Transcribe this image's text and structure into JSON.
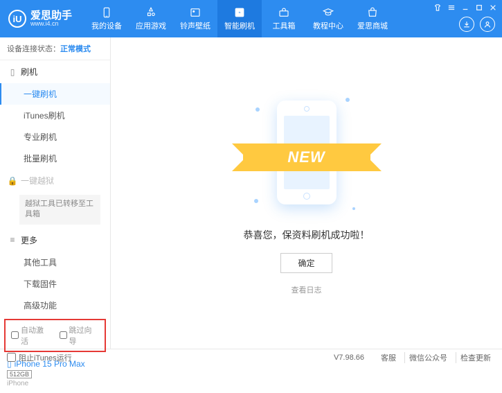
{
  "header": {
    "logo_letter": "iU",
    "app_name": "爱思助手",
    "url": "www.i4.cn",
    "nav": [
      {
        "label": "我的设备"
      },
      {
        "label": "应用游戏"
      },
      {
        "label": "铃声壁纸"
      },
      {
        "label": "智能刷机"
      },
      {
        "label": "工具箱"
      },
      {
        "label": "教程中心"
      },
      {
        "label": "爱思商城"
      }
    ]
  },
  "sidebar": {
    "conn_label": "设备连接状态：",
    "conn_mode": "正常模式",
    "sec_flash": "刷机",
    "items_flash": [
      "一键刷机",
      "iTunes刷机",
      "专业刷机",
      "批量刷机"
    ],
    "sec_jailbreak": "一键越狱",
    "jailbreak_note": "越狱工具已转移至工具箱",
    "sec_more": "更多",
    "items_more": [
      "其他工具",
      "下载固件",
      "高级功能"
    ],
    "chk_auto": "自动激活",
    "chk_skip": "跳过向导",
    "device_name": "iPhone 15 Pro Max",
    "device_storage": "512GB",
    "device_type": "iPhone"
  },
  "main": {
    "banner_text": "NEW",
    "message": "恭喜您，保资料刷机成功啦！",
    "ok_label": "确定",
    "log_link": "查看日志"
  },
  "footer": {
    "block_itunes": "阻止iTunes运行",
    "version": "V7.98.66",
    "links": [
      "客服",
      "微信公众号",
      "检查更新"
    ]
  }
}
